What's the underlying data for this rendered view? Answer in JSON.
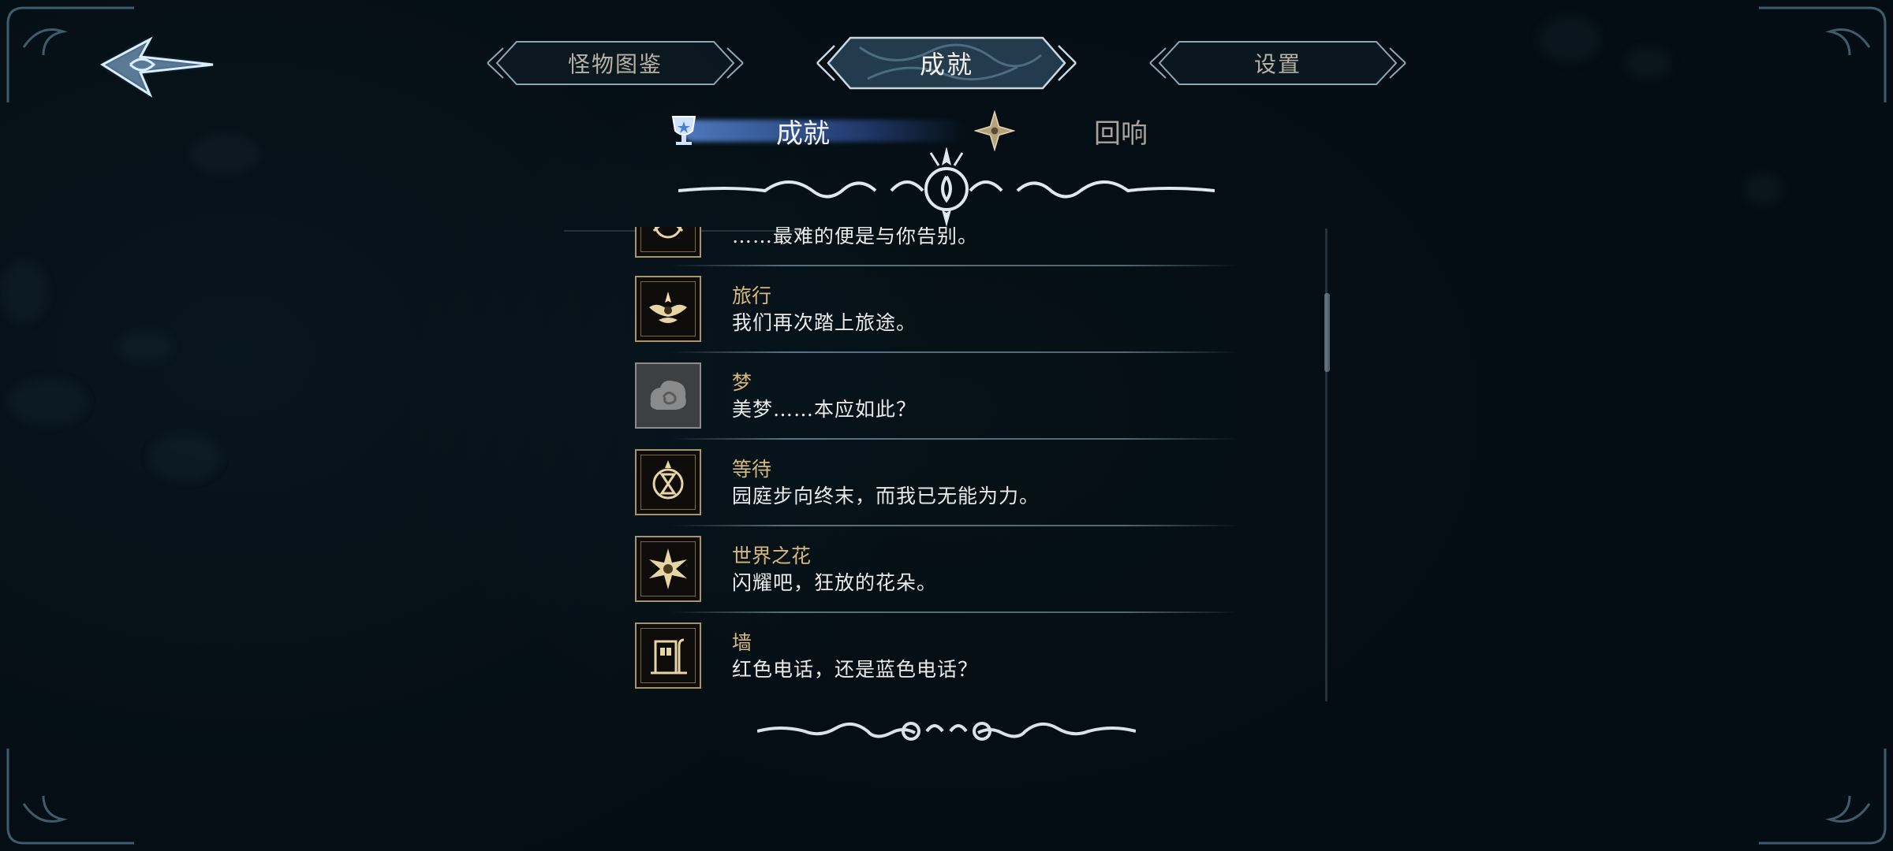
{
  "top_tabs": [
    {
      "label": "怪物图鉴"
    },
    {
      "label": "成就"
    },
    {
      "label": "设置"
    }
  ],
  "sub_tabs": [
    {
      "label": "成就",
      "icon": "trophy-icon"
    },
    {
      "label": "回响",
      "icon": "four-point-star-icon"
    }
  ],
  "achievements": [
    {
      "title": "",
      "desc": "……最难的便是与你告别。",
      "icon": "flower-mandala-icon",
      "locked": false
    },
    {
      "title": "旅行",
      "desc": "我们再次踏上旅途。",
      "icon": "winged-flower-icon",
      "locked": false
    },
    {
      "title": "梦",
      "desc": "美梦……本应如此？",
      "icon": "cloud-swirl-icon",
      "locked": true
    },
    {
      "title": "等待",
      "desc": "园庭步向终末，而我已无能为力。",
      "icon": "hourglass-icon",
      "locked": false
    },
    {
      "title": "世界之花",
      "desc": "闪耀吧，狂放的花朵。",
      "icon": "star-flower-icon",
      "locked": false
    },
    {
      "title": "墙",
      "desc": "红色电话，还是蓝色电话？",
      "icon": "phone-booth-icon",
      "locked": false
    }
  ],
  "colors": {
    "accent_blue": "#6fa6e6",
    "title_gold": "#d6b77c",
    "badge_gold": "#a8936a"
  }
}
